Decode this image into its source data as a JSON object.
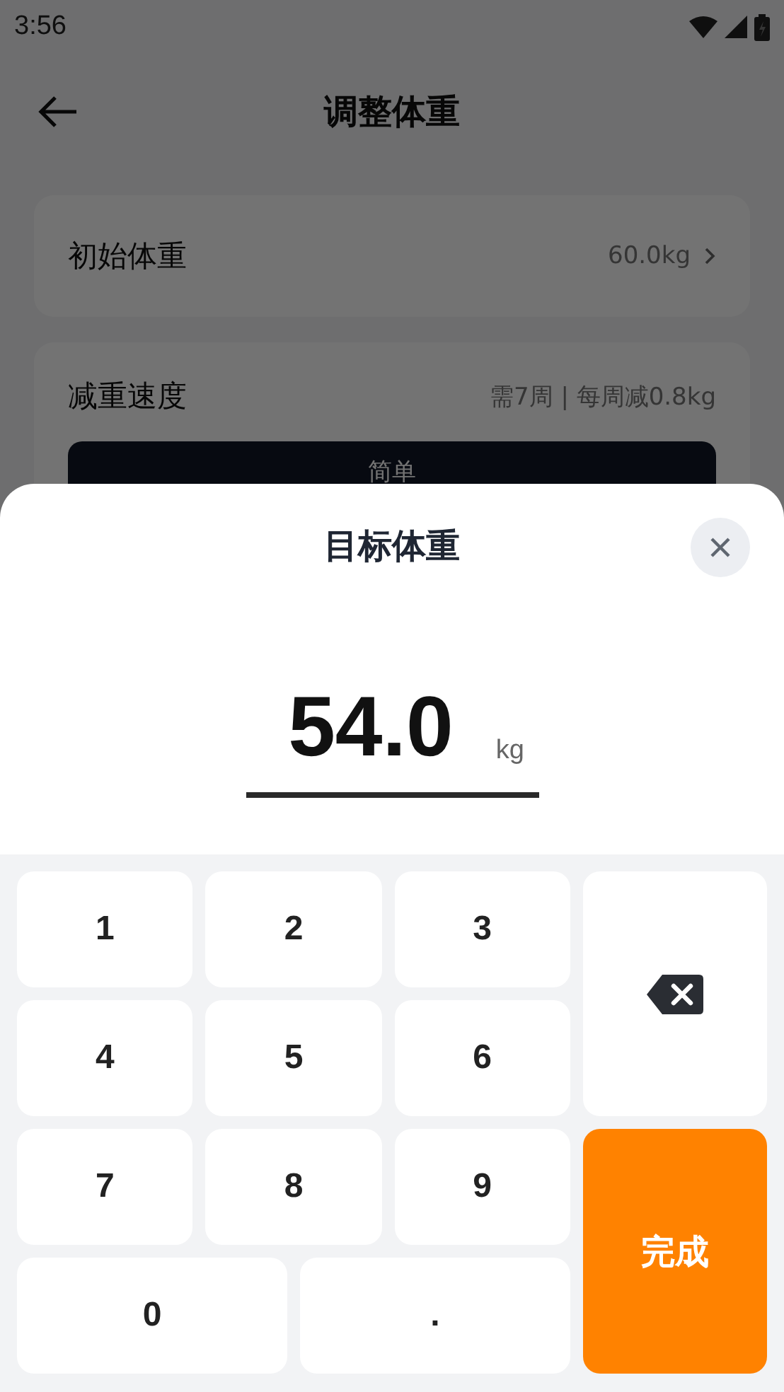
{
  "status_bar": {
    "time": "3:56"
  },
  "header": {
    "title": "调整体重"
  },
  "settings": [
    {
      "kind": "link",
      "label": "初始体重",
      "value": "60.0kg"
    },
    {
      "kind": "speed",
      "label": "减重速度",
      "value": "需7周 | 每周减0.8kg",
      "option": "简单"
    }
  ],
  "sheet": {
    "title": "目标体重",
    "value": "54.0",
    "unit": "kg"
  },
  "keypad": {
    "keys": [
      {
        "kind": "digit",
        "label": "1"
      },
      {
        "kind": "digit",
        "label": "2"
      },
      {
        "kind": "digit",
        "label": "3"
      },
      {
        "kind": "backspace"
      },
      {
        "kind": "digit",
        "label": "4"
      },
      {
        "kind": "digit",
        "label": "5"
      },
      {
        "kind": "digit",
        "label": "6"
      },
      {
        "kind": "digit",
        "label": "7"
      },
      {
        "kind": "digit",
        "label": "8"
      },
      {
        "kind": "digit",
        "label": "9"
      },
      {
        "kind": "done",
        "label": "完成"
      },
      {
        "kind": "wide",
        "label": "0"
      },
      {
        "kind": "wide",
        "label": "."
      }
    ]
  }
}
